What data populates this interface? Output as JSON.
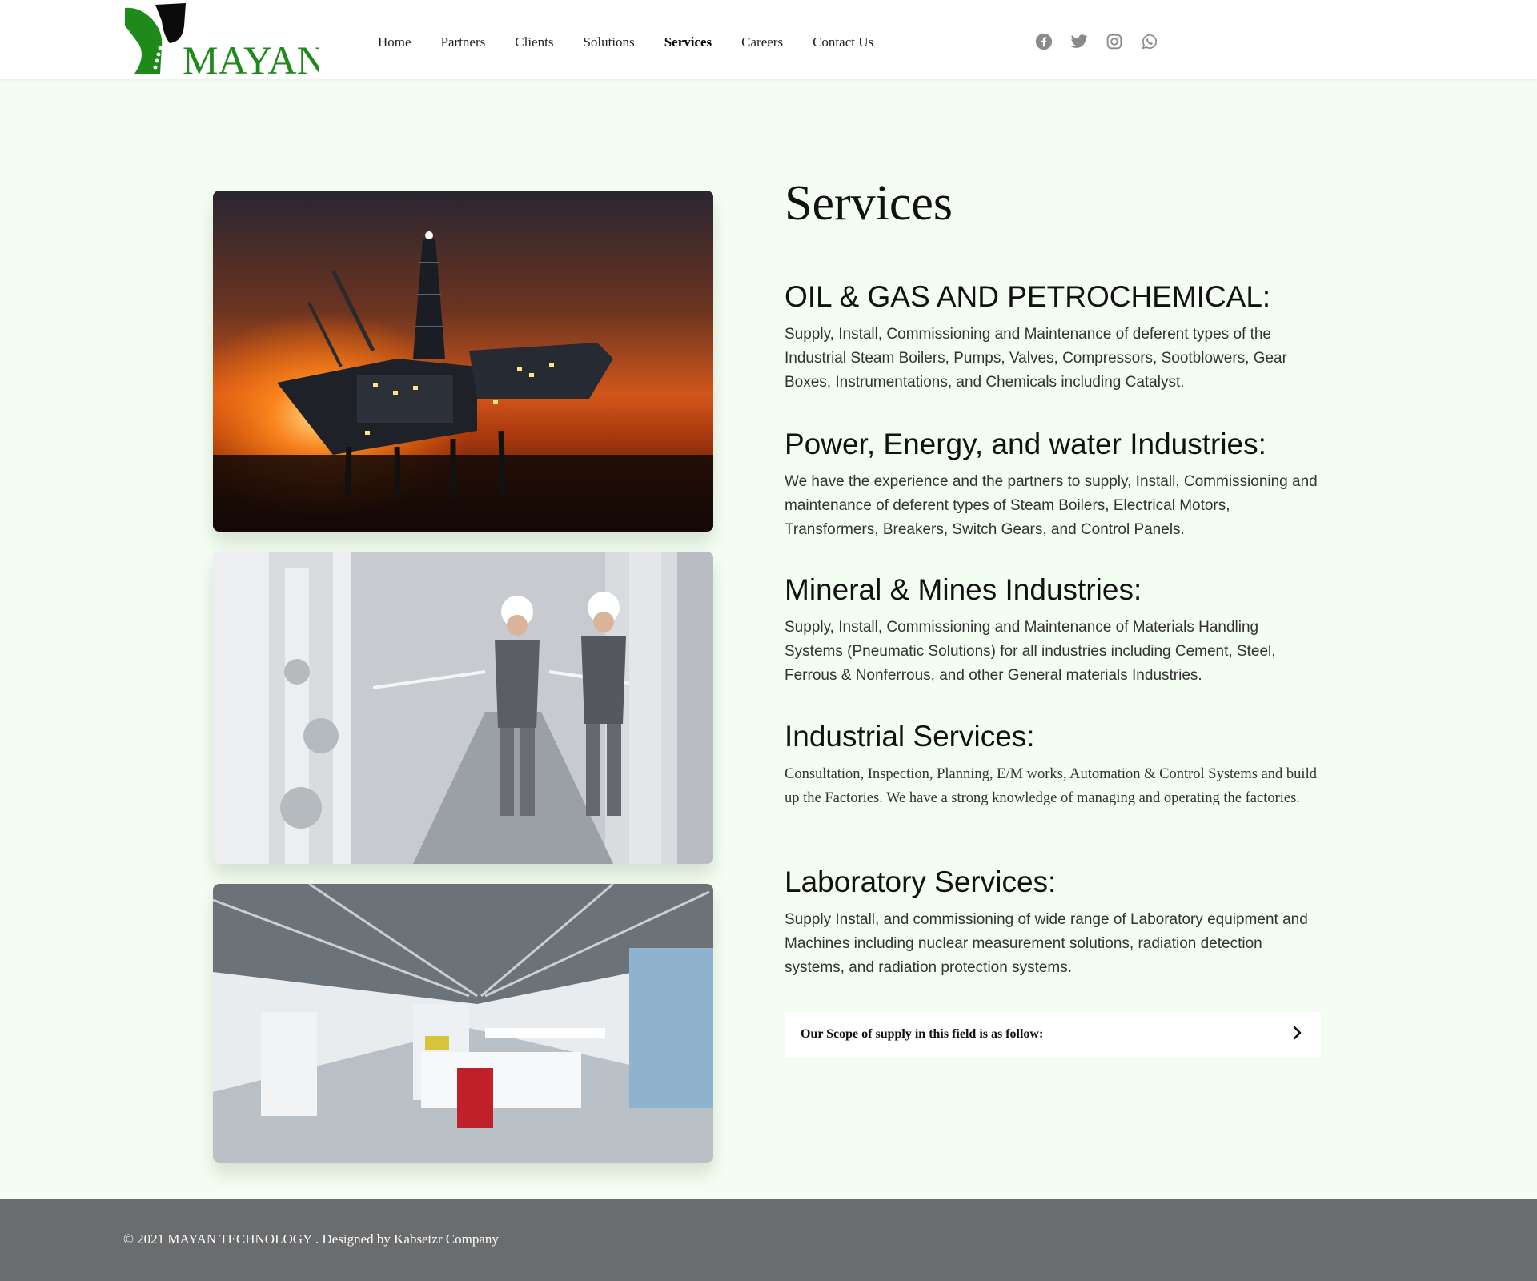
{
  "brand": {
    "name": "MAYAN",
    "accent_color": "#1d8a1a",
    "dark_color": "#111111"
  },
  "nav": {
    "items": [
      {
        "label": "Home",
        "active": false
      },
      {
        "label": "Partners",
        "active": false
      },
      {
        "label": "Clients",
        "active": false
      },
      {
        "label": "Solutions",
        "active": false
      },
      {
        "label": "Services",
        "active": true
      },
      {
        "label": "Careers",
        "active": false
      },
      {
        "label": "Contact Us",
        "active": false
      }
    ]
  },
  "social": [
    "facebook-icon",
    "twitter-icon",
    "instagram-icon",
    "whatsapp-icon"
  ],
  "page": {
    "title": "Services",
    "sections": [
      {
        "heading": "OIL & GAS AND PETROCHEMICAL:",
        "body": "Supply, Install, Commissioning and Maintenance of deferent types of the Industrial Steam Boilers, Pumps, Valves, Compressors, Sootblowers, Gear Boxes, Instrumentations, and Chemicals including Catalyst."
      },
      {
        "heading": "Power, Energy, and water Industries:",
        "body": "We have the experience and the partners to supply, Install, Commissioning and maintenance of deferent types of Steam Boilers, Electrical Motors, Transformers, Breakers, Switch Gears, and Control Panels."
      },
      {
        "heading": "Mineral & Mines Industries:",
        "body": "Supply, Install, Commissioning and Maintenance of Materials Handling Systems (Pneumatic Solutions) for all industries including Cement, Steel, Ferrous & Nonferrous, and other General materials Industries."
      },
      {
        "heading": "Industrial Services:",
        "body": "Consultation, Inspection, Planning, E/M works, Automation & Control Systems and build up the Factories. We have a strong knowledge of managing and operating the factories."
      },
      {
        "heading": "Laboratory Services:",
        "body": "Supply Install, and commissioning of wide range of Laboratory equipment and Machines including nuclear measurement solutions, radiation detection systems, and radiation protection systems."
      }
    ],
    "accordion_label": "Our Scope of supply in this field is as follow:"
  },
  "footer": {
    "copyright": "© 2021 MAYAN TECHNOLOGY . Designed by Kabsetzr Company"
  }
}
